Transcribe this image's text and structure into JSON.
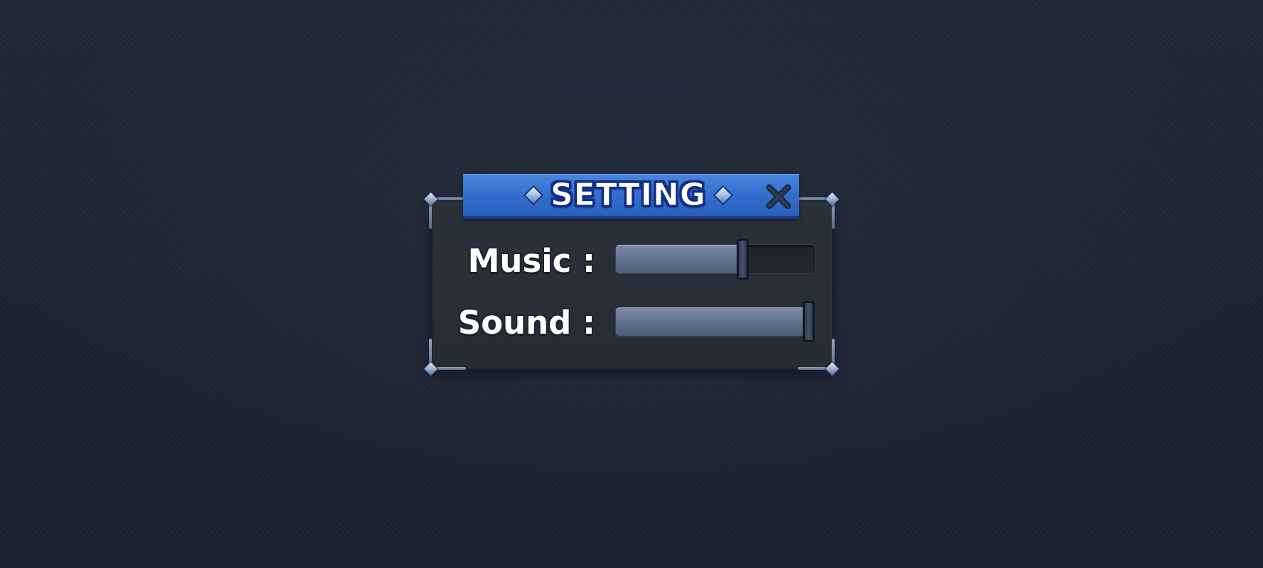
{
  "dialog": {
    "title": "SETTING",
    "close_icon": "close-icon"
  },
  "settings": [
    {
      "label": "Music :",
      "value": 0.64
    },
    {
      "label": "Sound :",
      "value": 1.0
    }
  ],
  "colors": {
    "banner": "#3470cf",
    "banner_outline": "#122e86",
    "panel": "#282d36",
    "slider_fill": "#61728d",
    "background": "#1e2533"
  }
}
